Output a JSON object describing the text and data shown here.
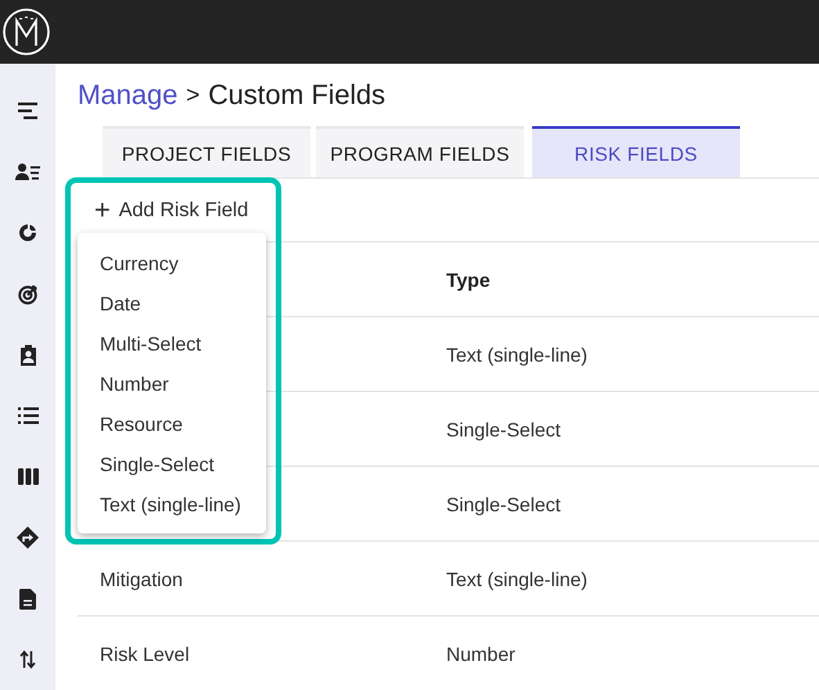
{
  "sidebar": {
    "items": [
      {
        "kind": "menu"
      },
      {
        "kind": "people"
      },
      {
        "kind": "ring"
      },
      {
        "kind": "target"
      },
      {
        "kind": "badge"
      },
      {
        "kind": "list"
      },
      {
        "kind": "columns"
      },
      {
        "kind": "directions"
      },
      {
        "kind": "document"
      },
      {
        "kind": "sort"
      }
    ]
  },
  "breadcrumb": {
    "parent": "Manage",
    "separator": ">",
    "current": "Custom Fields"
  },
  "tabs": [
    {
      "label": "PROJECT FIELDS",
      "selected": false
    },
    {
      "label": "PROGRAM FIELDS",
      "selected": false
    },
    {
      "label": "RISK FIELDS",
      "selected": true
    }
  ],
  "add_button": {
    "icon": "+",
    "label": "Add Risk Field"
  },
  "dropdown": {
    "highlighted": true,
    "items": [
      "Currency",
      "Date",
      "Multi-Select",
      "Number",
      "Resource",
      "Single-Select",
      "Text (single-line)"
    ]
  },
  "table": {
    "type_header": "Type",
    "rows": [
      {
        "type": "Text (single-line)"
      },
      {
        "type": "Single-Select"
      },
      {
        "type": "Single-Select"
      },
      {
        "name": "Mitigation",
        "type": "Text (single-line)"
      },
      {
        "name": "Risk Level",
        "type": "Number"
      }
    ]
  }
}
